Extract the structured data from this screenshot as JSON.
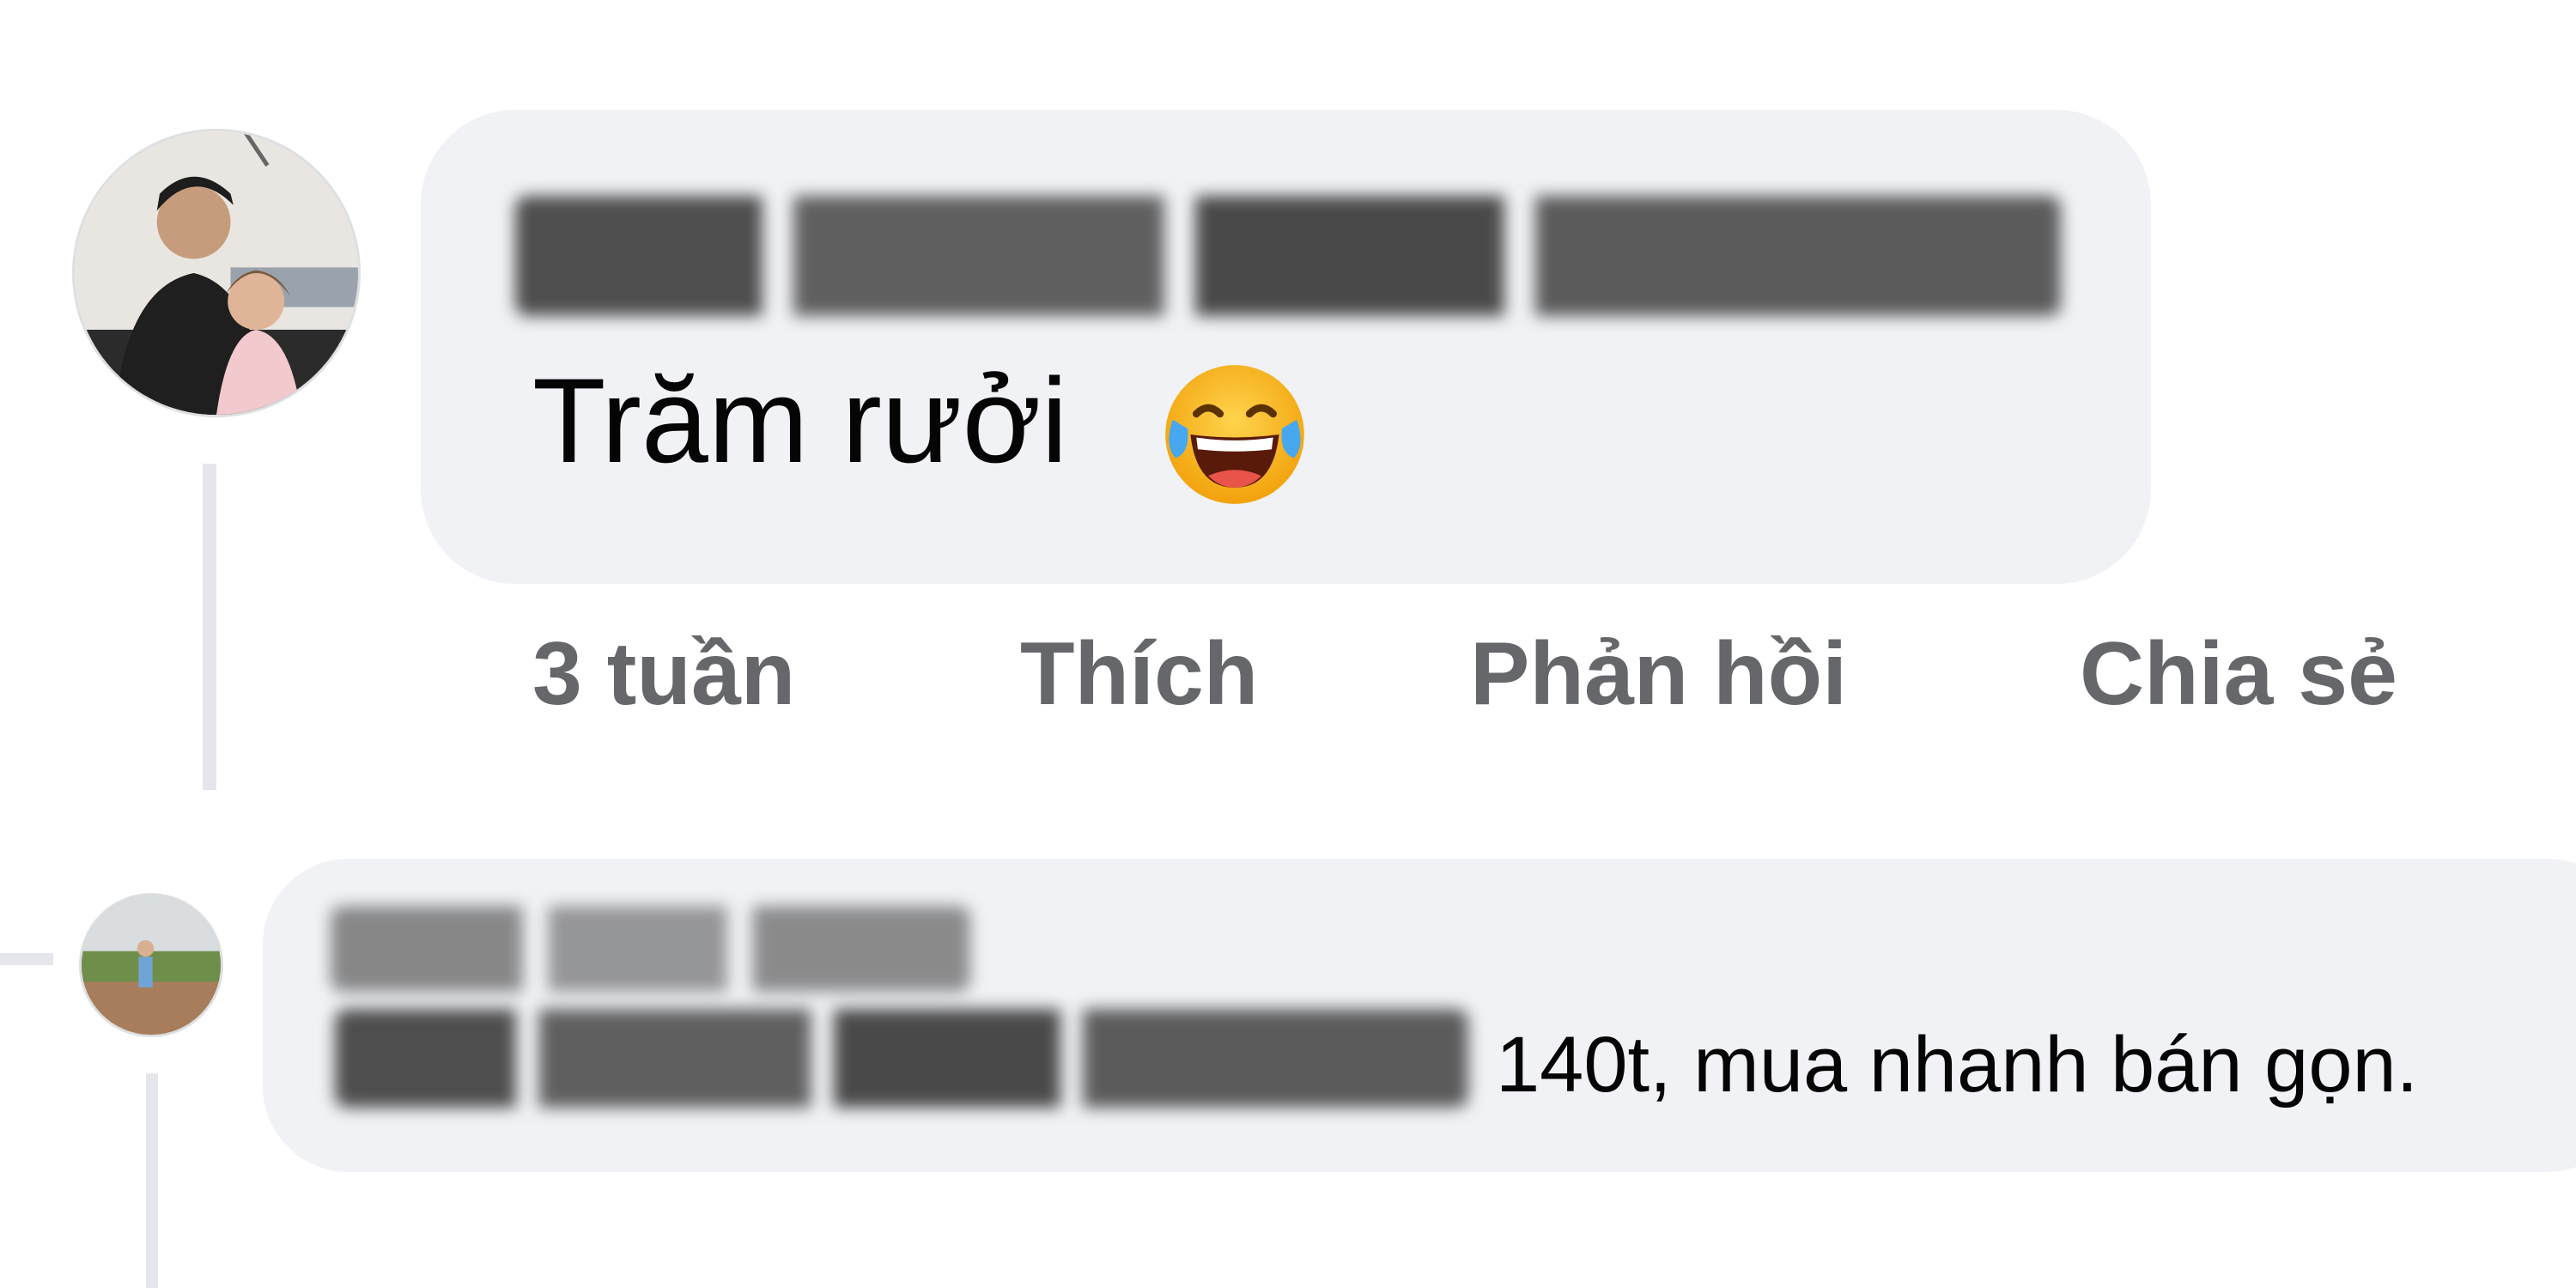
{
  "comment": {
    "author_name": "Phạm Khương Duhọc Kkid",
    "text": "Trăm rưởi",
    "emoji_icon": "face-with-tears-of-joy-icon",
    "time_label": "3 tuần",
    "like_label": "Thích",
    "reply_label": "Phản hồi",
    "share_label": "Chia sẻ"
  },
  "reply": {
    "author_name": "Nguyễn Huy Kkn",
    "mention": "Phạm Khương Duhọc Kkid",
    "text": "140t, mua nhanh bán gọn."
  },
  "colors": {
    "bubble": "#f0f2f5",
    "action_text": "#65676b",
    "thread_line": "#e4e6eb"
  }
}
